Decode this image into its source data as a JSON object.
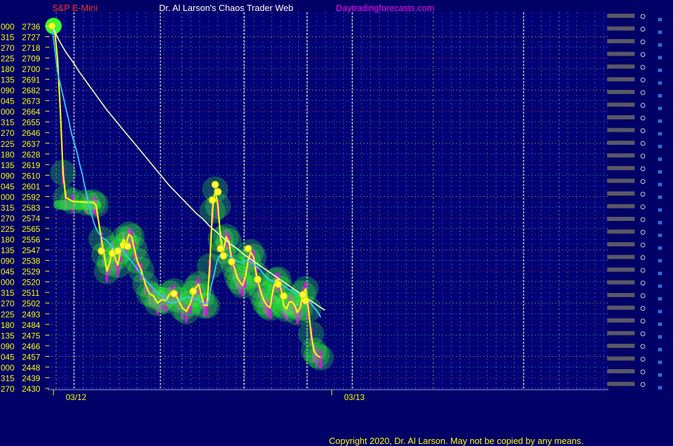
{
  "header": {
    "symbol": "S&P E-Mini",
    "site": "Dr. Al Larson's Chaos Trader Web",
    "url": "Daytradingforecasts.com"
  },
  "footer": {
    "copyright": "Copyright 2020, Dr. Al Larson. May not be copied by any means."
  },
  "colors": {
    "background": "#000066",
    "axis_text": "#ffff00",
    "header_symbol": "#ff3030",
    "header_site": "#ffffff",
    "header_url": "#ff00ff",
    "price_line": "#ffff00",
    "average_line": "#33ccff",
    "forecast_line": "#ffffcc",
    "marker": "#ffff33",
    "halo": "#33ff33",
    "magenta_bar": "#ff00ff"
  },
  "chart_data": {
    "type": "line",
    "title": "S&P E-Mini",
    "xlabel": "",
    "ylabel": "",
    "x_tick_labels": [
      "03/12",
      "03/13"
    ],
    "ylim": [
      2430,
      2740
    ],
    "y_tick_angles": [
      "000",
      "315",
      "270",
      "225",
      "180",
      "135",
      "090",
      "045",
      "000",
      "315",
      "270",
      "225",
      "180",
      "135",
      "090",
      "045",
      "000",
      "315",
      "270",
      "225",
      "180",
      "135",
      "090",
      "045",
      "000",
      "315",
      "270",
      "225",
      "180",
      "135",
      "090",
      "045",
      "000",
      "315",
      "270"
    ],
    "y_tick_prices": [
      2736,
      2727,
      2718,
      2709,
      2700,
      2691,
      2682,
      2673,
      2664,
      2655,
      2646,
      2637,
      2628,
      2619,
      2610,
      2601,
      2592,
      2583,
      2574,
      2565,
      2556,
      2547,
      2538,
      2529,
      2520,
      2511,
      2502,
      2493,
      2484,
      2475,
      2466,
      2457,
      2448,
      2439,
      2430
    ],
    "series": [
      {
        "values": [
          [
            0,
            2736
          ],
          [
            4,
            2731
          ],
          [
            8,
            2708
          ],
          [
            12,
            2665
          ],
          [
            16,
            2612
          ],
          [
            20,
            2591
          ],
          [
            30,
            2588
          ],
          [
            50,
            2587
          ],
          [
            60,
            2587
          ],
          [
            64,
            2585
          ],
          [
            72,
            2556
          ],
          [
            76,
            2543
          ],
          [
            80,
            2529
          ],
          [
            84,
            2536
          ],
          [
            88,
            2548
          ],
          [
            92,
            2540
          ],
          [
            96,
            2534
          ],
          [
            100,
            2546
          ],
          [
            104,
            2556
          ],
          [
            108,
            2552
          ],
          [
            112,
            2560
          ],
          [
            116,
            2558
          ],
          [
            120,
            2548
          ],
          [
            124,
            2538
          ],
          [
            130,
            2530
          ],
          [
            136,
            2518
          ],
          [
            142,
            2510
          ],
          [
            148,
            2508
          ],
          [
            154,
            2502
          ],
          [
            160,
            2505
          ],
          [
            166,
            2504
          ],
          [
            172,
            2510
          ],
          [
            178,
            2512
          ],
          [
            184,
            2505
          ],
          [
            190,
            2498
          ],
          [
            196,
            2495
          ],
          [
            202,
            2502
          ],
          [
            206,
            2510
          ],
          [
            210,
            2515
          ],
          [
            214,
            2518
          ],
          [
            218,
            2508
          ],
          [
            222,
            2500
          ],
          [
            226,
            2500
          ],
          [
            230,
            2533
          ],
          [
            234,
            2580
          ],
          [
            238,
            2598
          ],
          [
            242,
            2584
          ],
          [
            246,
            2556
          ],
          [
            250,
            2546
          ],
          [
            254,
            2558
          ],
          [
            258,
            2554
          ],
          [
            262,
            2539
          ],
          [
            266,
            2532
          ],
          [
            270,
            2524
          ],
          [
            274,
            2520
          ],
          [
            278,
            2517
          ],
          [
            282,
            2524
          ],
          [
            286,
            2538
          ],
          [
            290,
            2545
          ],
          [
            294,
            2541
          ],
          [
            298,
            2526
          ],
          [
            302,
            2517
          ],
          [
            306,
            2509
          ],
          [
            310,
            2503
          ],
          [
            314,
            2500
          ],
          [
            318,
            2498
          ],
          [
            322,
            2512
          ],
          [
            326,
            2521
          ],
          [
            330,
            2522
          ],
          [
            334,
            2514
          ],
          [
            338,
            2500
          ],
          [
            342,
            2497
          ],
          [
            346,
            2503
          ],
          [
            350,
            2503
          ],
          [
            354,
            2500
          ],
          [
            358,
            2494
          ],
          [
            362,
            2498
          ],
          [
            366,
            2510
          ],
          [
            370,
            2514
          ],
          [
            374,
            2497
          ],
          [
            378,
            2476
          ],
          [
            382,
            2462
          ],
          [
            386,
            2458
          ],
          [
            392,
            2456
          ]
        ]
      },
      {
        "values": [
          [
            0,
            2736
          ],
          [
            4,
            2716
          ],
          [
            8,
            2697
          ],
          [
            12,
            2687
          ],
          [
            16,
            2677
          ],
          [
            20,
            2667
          ],
          [
            24,
            2657
          ],
          [
            28,
            2646
          ],
          [
            32,
            2638
          ],
          [
            36,
            2630
          ],
          [
            40,
            2620
          ],
          [
            44,
            2611
          ],
          [
            48,
            2600
          ],
          [
            52,
            2590
          ],
          [
            56,
            2580
          ],
          [
            60,
            2572
          ],
          [
            64,
            2565
          ],
          [
            68,
            2561
          ],
          [
            72,
            2558
          ],
          [
            76,
            2556
          ],
          [
            80,
            2555
          ],
          [
            84,
            2552
          ],
          [
            88,
            2549
          ],
          [
            92,
            2547
          ],
          [
            96,
            2548
          ],
          [
            100,
            2550
          ],
          [
            104,
            2546
          ],
          [
            108,
            2543
          ],
          [
            112,
            2540
          ],
          [
            116,
            2537
          ],
          [
            120,
            2534
          ],
          [
            124,
            2531
          ],
          [
            128,
            2528
          ],
          [
            132,
            2525
          ],
          [
            136,
            2522
          ],
          [
            140,
            2519
          ],
          [
            144,
            2517
          ],
          [
            148,
            2514
          ],
          [
            152,
            2511
          ],
          [
            156,
            2510
          ],
          [
            160,
            2508
          ],
          [
            164,
            2506
          ],
          [
            168,
            2504
          ],
          [
            172,
            2502
          ],
          [
            176,
            2502
          ],
          [
            180,
            2503
          ],
          [
            184,
            2504
          ],
          [
            188,
            2505
          ],
          [
            192,
            2506
          ],
          [
            196,
            2507
          ],
          [
            200,
            2507
          ],
          [
            204,
            2506
          ],
          [
            208,
            2506
          ],
          [
            212,
            2505
          ],
          [
            216,
            2504
          ],
          [
            220,
            2502
          ],
          [
            224,
            2501
          ],
          [
            228,
            2503
          ],
          [
            232,
            2516
          ],
          [
            236,
            2525
          ],
          [
            240,
            2536
          ],
          [
            244,
            2542
          ],
          [
            248,
            2543
          ],
          [
            252,
            2544
          ],
          [
            256,
            2543
          ],
          [
            260,
            2541
          ],
          [
            264,
            2540
          ],
          [
            268,
            2538
          ],
          [
            272,
            2537
          ],
          [
            276,
            2536
          ],
          [
            280,
            2537
          ],
          [
            284,
            2538
          ],
          [
            288,
            2537
          ],
          [
            292,
            2536
          ],
          [
            296,
            2534
          ],
          [
            300,
            2532
          ],
          [
            304,
            2530
          ],
          [
            308,
            2527
          ],
          [
            312,
            2524
          ],
          [
            316,
            2522
          ],
          [
            320,
            2521
          ],
          [
            324,
            2520
          ],
          [
            328,
            2519
          ],
          [
            332,
            2518
          ],
          [
            336,
            2517
          ],
          [
            340,
            2516
          ],
          [
            344,
            2514
          ],
          [
            348,
            2513
          ],
          [
            352,
            2512
          ],
          [
            356,
            2510
          ],
          [
            360,
            2509
          ],
          [
            364,
            2508
          ],
          [
            368,
            2507
          ],
          [
            372,
            2505
          ],
          [
            376,
            2503
          ],
          [
            380,
            2500
          ],
          [
            384,
            2497
          ],
          [
            388,
            2494
          ],
          [
            392,
            2490
          ]
        ]
      },
      {
        "values": [
          [
            0,
            2736
          ],
          [
            10,
            2724
          ],
          [
            20,
            2714
          ],
          [
            30,
            2706
          ],
          [
            40,
            2697
          ],
          [
            50,
            2689
          ],
          [
            60,
            2681
          ],
          [
            70,
            2673
          ],
          [
            80,
            2665
          ],
          [
            90,
            2658
          ],
          [
            100,
            2651
          ],
          [
            110,
            2644
          ],
          [
            120,
            2637
          ],
          [
            130,
            2630
          ],
          [
            140,
            2623
          ],
          [
            150,
            2616
          ],
          [
            160,
            2609
          ],
          [
            170,
            2602
          ],
          [
            180,
            2596
          ],
          [
            190,
            2590
          ],
          [
            200,
            2584
          ],
          [
            210,
            2578
          ],
          [
            220,
            2573
          ],
          [
            230,
            2567
          ],
          [
            240,
            2562
          ],
          [
            250,
            2557
          ],
          [
            260,
            2552
          ],
          [
            270,
            2548
          ],
          [
            280,
            2543
          ],
          [
            290,
            2539
          ],
          [
            300,
            2535
          ],
          [
            310,
            2531
          ],
          [
            320,
            2527
          ],
          [
            330,
            2523
          ],
          [
            340,
            2519
          ],
          [
            350,
            2515
          ],
          [
            360,
            2511
          ],
          [
            370,
            2507
          ],
          [
            380,
            2503
          ],
          [
            390,
            2499
          ],
          [
            398,
            2496
          ]
        ]
      }
    ],
    "marker_points": [
      [
        0,
        2736
      ],
      [
        72,
        2546
      ],
      [
        88,
        2544
      ],
      [
        96,
        2546
      ],
      [
        104,
        2551
      ],
      [
        110,
        2550
      ],
      [
        178,
        2510
      ],
      [
        206,
        2512
      ],
      [
        234,
        2589
      ],
      [
        238,
        2602
      ],
      [
        242,
        2596
      ],
      [
        246,
        2548
      ],
      [
        250,
        2542
      ],
      [
        262,
        2537
      ],
      [
        286,
        2548
      ],
      [
        300,
        2522
      ],
      [
        330,
        2518
      ],
      [
        338,
        2508
      ],
      [
        366,
        2509
      ],
      [
        370,
        2504
      ]
    ],
    "grid": true,
    "legend": "none"
  }
}
